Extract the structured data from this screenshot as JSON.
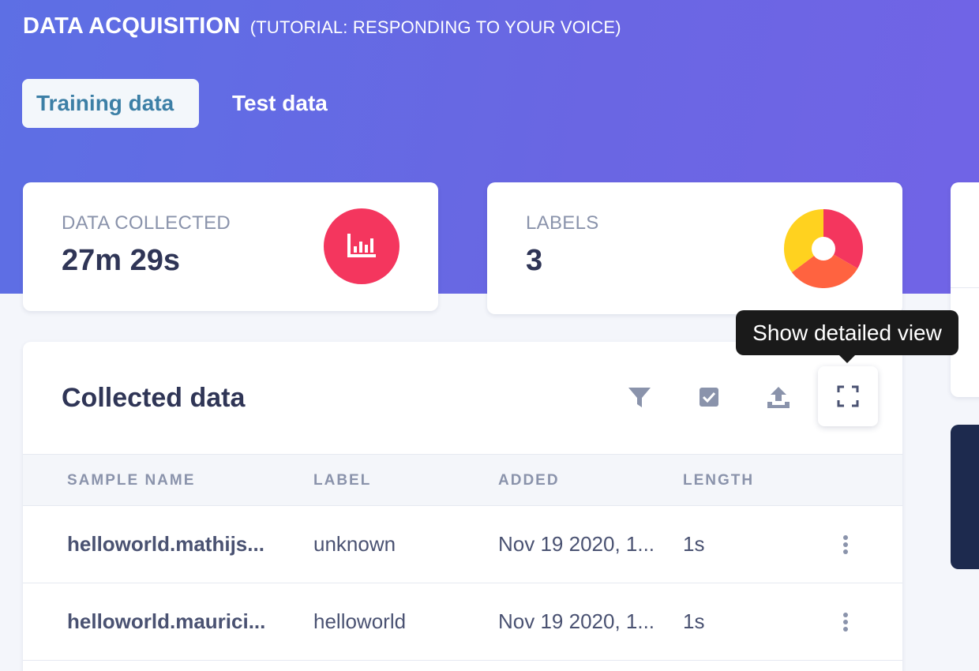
{
  "header": {
    "title": "DATA ACQUISITION",
    "subtitle": "(TUTORIAL: RESPONDING TO YOUR VOICE)"
  },
  "tabs": [
    {
      "label": "Training data",
      "active": true
    },
    {
      "label": "Test data",
      "active": false
    }
  ],
  "stats": {
    "data_collected": {
      "label": "DATA COLLECTED",
      "value": "27m 29s",
      "icon": "bar-chart-icon",
      "color": "#f4365e"
    },
    "labels": {
      "label": "LABELS",
      "value": "3",
      "icon": "pie-chart-icon",
      "colors": [
        "#f4365e",
        "#ff6340",
        "#ffd21f"
      ]
    }
  },
  "collected": {
    "title": "Collected data",
    "toolbar": [
      "filter-icon",
      "checkbox-icon",
      "upload-icon",
      "expand-icon"
    ],
    "tooltip": "Show detailed view",
    "columns": [
      "SAMPLE NAME",
      "LABEL",
      "ADDED",
      "LENGTH"
    ],
    "rows": [
      {
        "name": "helloworld.mathijs...",
        "label": "unknown",
        "added": "Nov 19 2020, 1...",
        "length": "1s"
      },
      {
        "name": "helloworld.maurici...",
        "label": "helloworld",
        "added": "Nov 19 2020, 1...",
        "length": "1s"
      }
    ]
  },
  "colors": {
    "accent": "#6a66e3",
    "active_tab_text": "#3c7fa6"
  }
}
